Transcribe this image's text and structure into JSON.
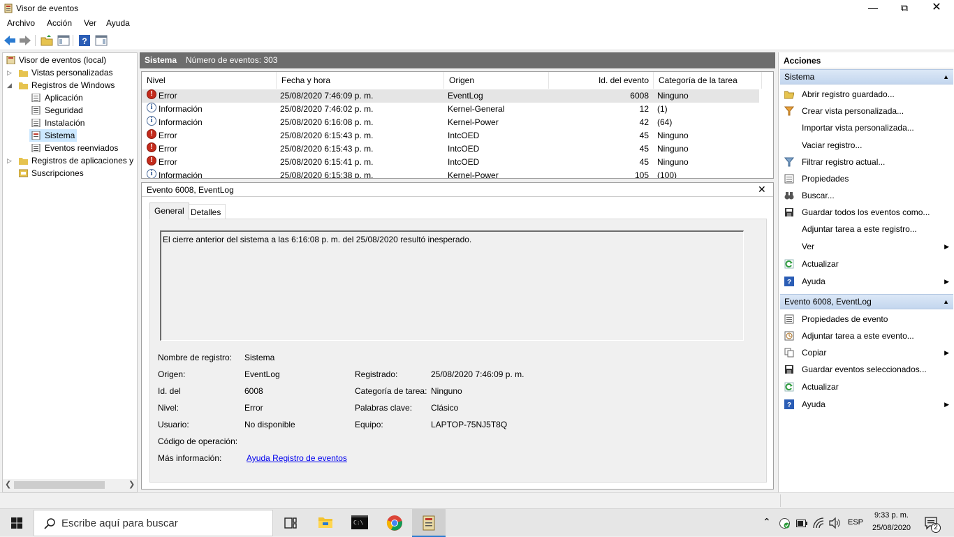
{
  "window": {
    "title": "Visor de eventos"
  },
  "menu": [
    "Archivo",
    "Acción",
    "Ver",
    "Ayuda"
  ],
  "tree": {
    "root": "Visor de eventos (local)",
    "custom_views": "Vistas personalizadas",
    "windows_logs": "Registros de Windows",
    "windows_children": [
      "Aplicación",
      "Seguridad",
      "Instalación",
      "Sistema",
      "Eventos reenviados"
    ],
    "apps_logs": "Registros de aplicaciones y s",
    "subscriptions": "Suscripciones"
  },
  "center": {
    "title": "Sistema",
    "count_label": "Número de eventos: 303"
  },
  "columns": [
    "Nivel",
    "Fecha y hora",
    "Origen",
    "Id. del evento",
    "Categoría de la tarea"
  ],
  "events": [
    {
      "level": "Error",
      "date": "25/08/2020 7:46:09 p. m.",
      "source": "EventLog",
      "id": "6008",
      "category": "Ninguno",
      "type": "error"
    },
    {
      "level": "Información",
      "date": "25/08/2020 7:46:02 p. m.",
      "source": "Kernel-General",
      "id": "12",
      "category": "(1)",
      "type": "info"
    },
    {
      "level": "Información",
      "date": "25/08/2020 6:16:08 p. m.",
      "source": "Kernel-Power",
      "id": "42",
      "category": "(64)",
      "type": "info"
    },
    {
      "level": "Error",
      "date": "25/08/2020 6:15:43 p. m.",
      "source": "IntcOED",
      "id": "45",
      "category": "Ninguno",
      "type": "error"
    },
    {
      "level": "Error",
      "date": "25/08/2020 6:15:43 p. m.",
      "source": "IntcOED",
      "id": "45",
      "category": "Ninguno",
      "type": "error"
    },
    {
      "level": "Error",
      "date": "25/08/2020 6:15:41 p. m.",
      "source": "IntcOED",
      "id": "45",
      "category": "Ninguno",
      "type": "error"
    },
    {
      "level": "Información",
      "date": "25/08/2020 6:15:38 p. m.",
      "source": "Kernel-Power",
      "id": "105",
      "category": "(100)",
      "type": "info"
    }
  ],
  "detail": {
    "title": "Evento 6008, EventLog",
    "tabs": [
      "General",
      "Detalles"
    ],
    "message": "El cierre anterior del sistema a las 6:16:08 p. m. del 25/08/2020 resultó inesperado.",
    "fields": {
      "log_name_label": "Nombre de registro:",
      "log_name": "Sistema",
      "source_label": "Origen:",
      "source": "EventLog",
      "logged_label": "Registrado:",
      "logged": "25/08/2020 7:46:09 p. m.",
      "id_label": "Id. del",
      "id": "6008",
      "category_label": "Categoría de tarea:",
      "category": "Ninguno",
      "level_label": "Nivel:",
      "level": "Error",
      "keywords_label": "Palabras clave:",
      "keywords": "Clásico",
      "user_label": "Usuario:",
      "user": "No disponible",
      "computer_label": "Equipo:",
      "computer": "LAPTOP-75NJ5T8Q",
      "opcode_label": "Código de operación:",
      "more_label": "Más información:",
      "more_link": "Ayuda Registro de eventos"
    }
  },
  "actions": {
    "title": "Acciones",
    "section1": "Sistema",
    "items1": [
      "Abrir registro guardado...",
      "Crear vista personalizada...",
      "Importar vista personalizada...",
      "Vaciar registro...",
      "Filtrar registro actual...",
      "Propiedades",
      "Buscar...",
      "Guardar todos los eventos como...",
      "Adjuntar tarea a este registro...",
      "Ver",
      "Actualizar",
      "Ayuda"
    ],
    "section2": "Evento 6008, EventLog",
    "items2": [
      "Propiedades de evento",
      "Adjuntar tarea a este evento...",
      "Copiar",
      "Guardar eventos seleccionados...",
      "Actualizar",
      "Ayuda"
    ]
  },
  "taskbar": {
    "search_placeholder": "Escribe aquí para buscar",
    "lang": "ESP",
    "time": "9:33 p. m.",
    "date": "25/08/2020",
    "notifications": "2"
  }
}
